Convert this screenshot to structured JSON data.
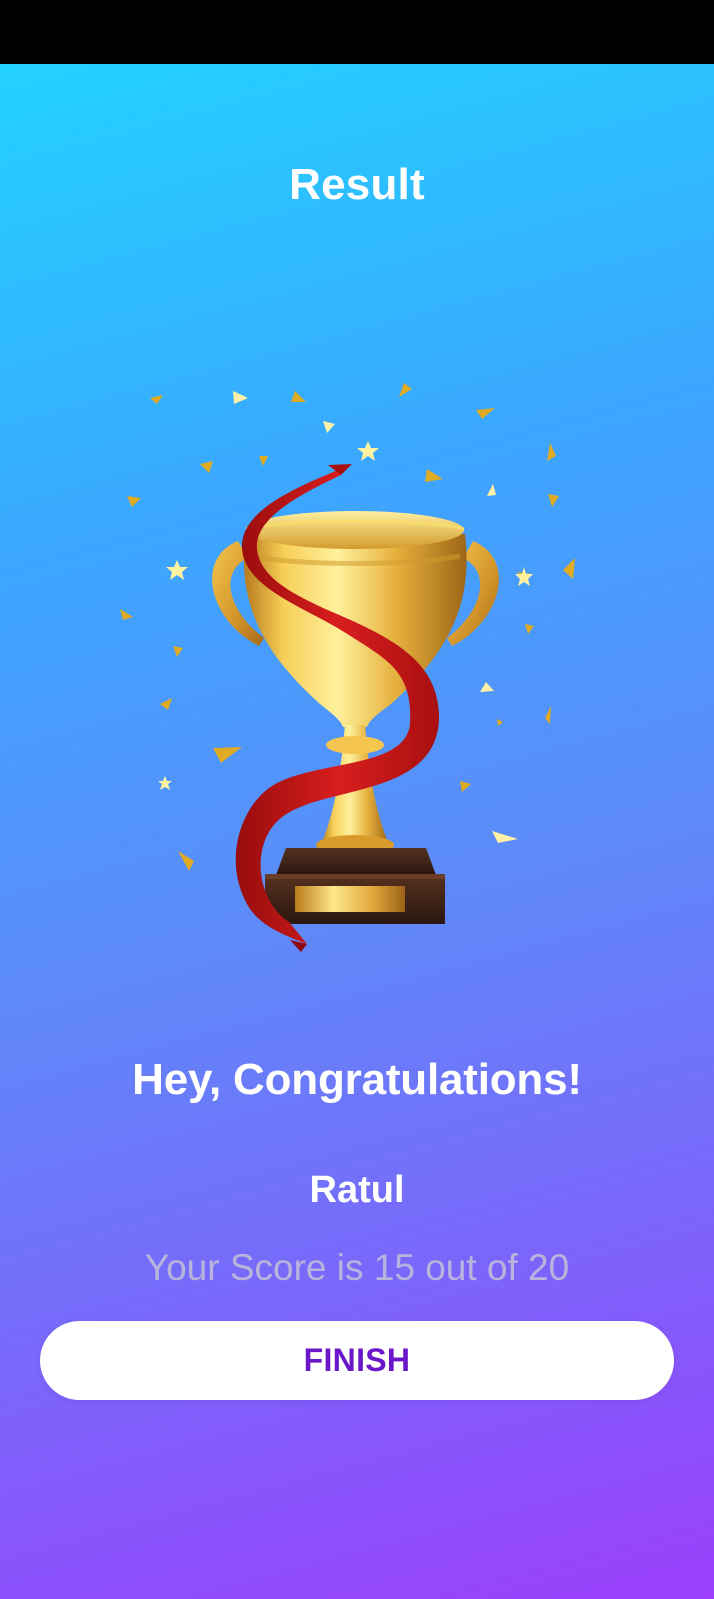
{
  "header": {
    "title": "Result"
  },
  "illustration": {
    "icon": "trophy-icon",
    "colors": {
      "gold": "#e9b22d",
      "ribbon": "#c51616",
      "base": "#3d2419"
    }
  },
  "result": {
    "greeting": "Hey, Congratulations!",
    "player_name": "Ratul",
    "score_text": "Your Score is 15 out of 20"
  },
  "actions": {
    "finish_label": "FINISH"
  }
}
